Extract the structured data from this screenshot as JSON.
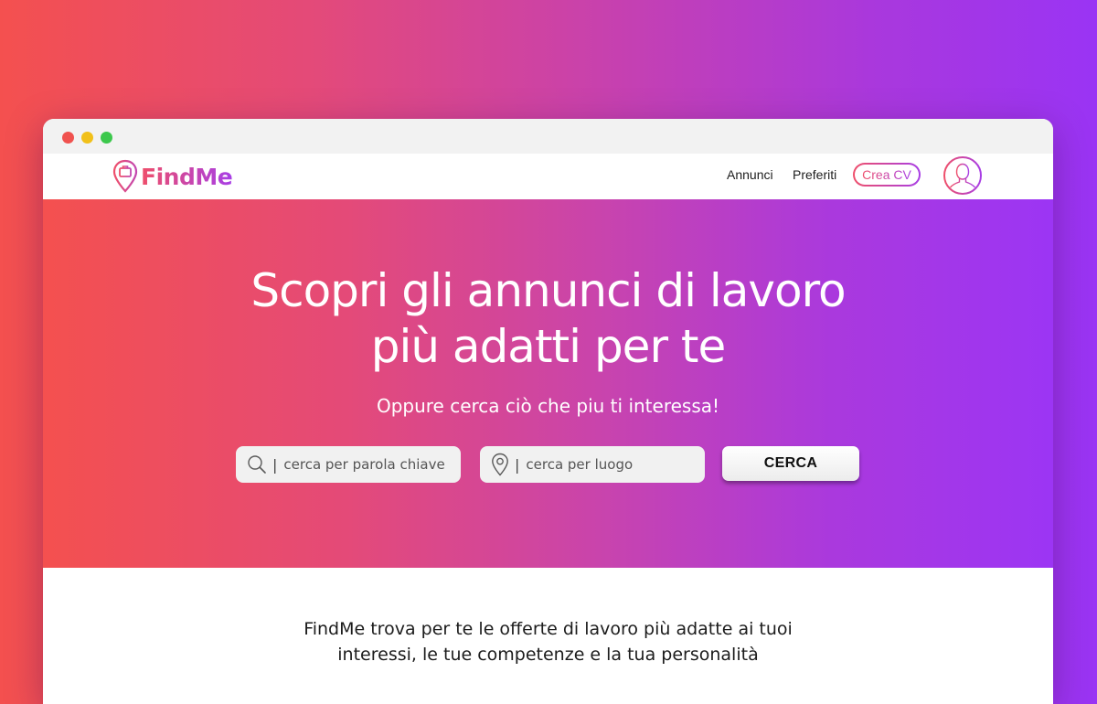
{
  "brand": {
    "name": "FindMe",
    "gradient_start": "#ef4f6a",
    "gradient_end": "#a83ee6"
  },
  "browser_chrome": {
    "window_dots": [
      "close",
      "minimize",
      "maximize"
    ]
  },
  "navbar": {
    "links": [
      "Annunci",
      "Preferiti"
    ],
    "cta_label": "Crea CV",
    "avatar_icon": "user-avatar-icon"
  },
  "hero": {
    "title_line1": "Scopri gli annunci di lavoro",
    "title_line2": "più adatti per te",
    "subtitle": "Oppure cerca ciò che piu ti interessa!",
    "keyword_search": {
      "icon": "search-icon",
      "placeholder": "cerca per parola chiave"
    },
    "location_search": {
      "icon": "location-pin-icon",
      "placeholder": "cerca per luogo"
    },
    "search_button_label": "CERCA",
    "gradient_start": "#f4504f",
    "gradient_end": "#9c35f4"
  },
  "intro": {
    "line1": "FindMe trova per te le offerte di lavoro più adatte ai tuoi",
    "line2": "interessi, le tue competenze e la tua personalità"
  }
}
